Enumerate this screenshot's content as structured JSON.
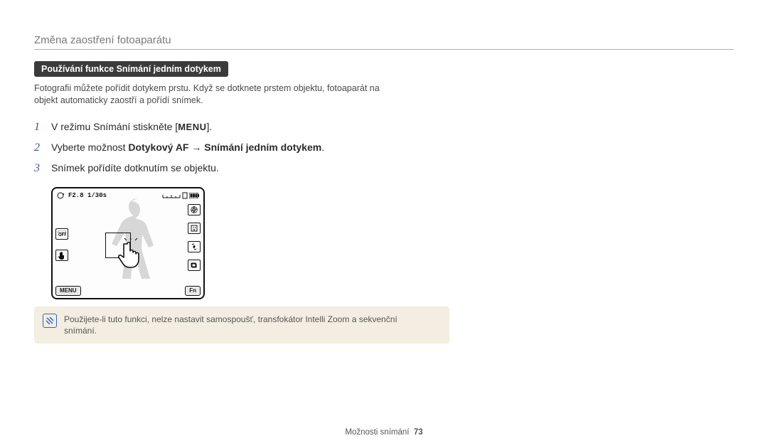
{
  "header": {
    "section_title": "Změna zaostření fotoaparátu"
  },
  "badge": "Používání funkce Snímání jedním dotykem",
  "intro": "Fotografii můžete pořídit dotykem prstu. Když se dotknete prstem objektu, fotoaparát na objekt automaticky zaostří a pořídí snímek.",
  "steps": [
    {
      "num": "1",
      "text_pre": "V režimu Snímání stiskněte [",
      "menu_glyph": "MENU",
      "text_post": "]."
    },
    {
      "num": "2",
      "text_pre": "Vyberte možnost ",
      "bold1": "Dotykový AF",
      "arrow": " → ",
      "bold2": "Snímání jedním dotykem",
      "text_post": "."
    },
    {
      "num": "3",
      "text_pre": "Snímek pořídíte dotknutím se objektu."
    }
  ],
  "screen": {
    "exposure": "F2.8 1/30s",
    "btn_menu": "MENU",
    "btn_fn": "Fn",
    "icons_left": [
      "off-icon",
      "touch-icon"
    ],
    "icons_right": [
      "flash-icon",
      "face-icon",
      "stabilize-icon",
      "drive-icon"
    ]
  },
  "note": "Použijete-li tuto funkci, nelze nastavit samospoušť, transfokátor Intelli Zoom a sekvenční snímání.",
  "footer": {
    "label": "Možnosti snímání",
    "page": "73"
  }
}
